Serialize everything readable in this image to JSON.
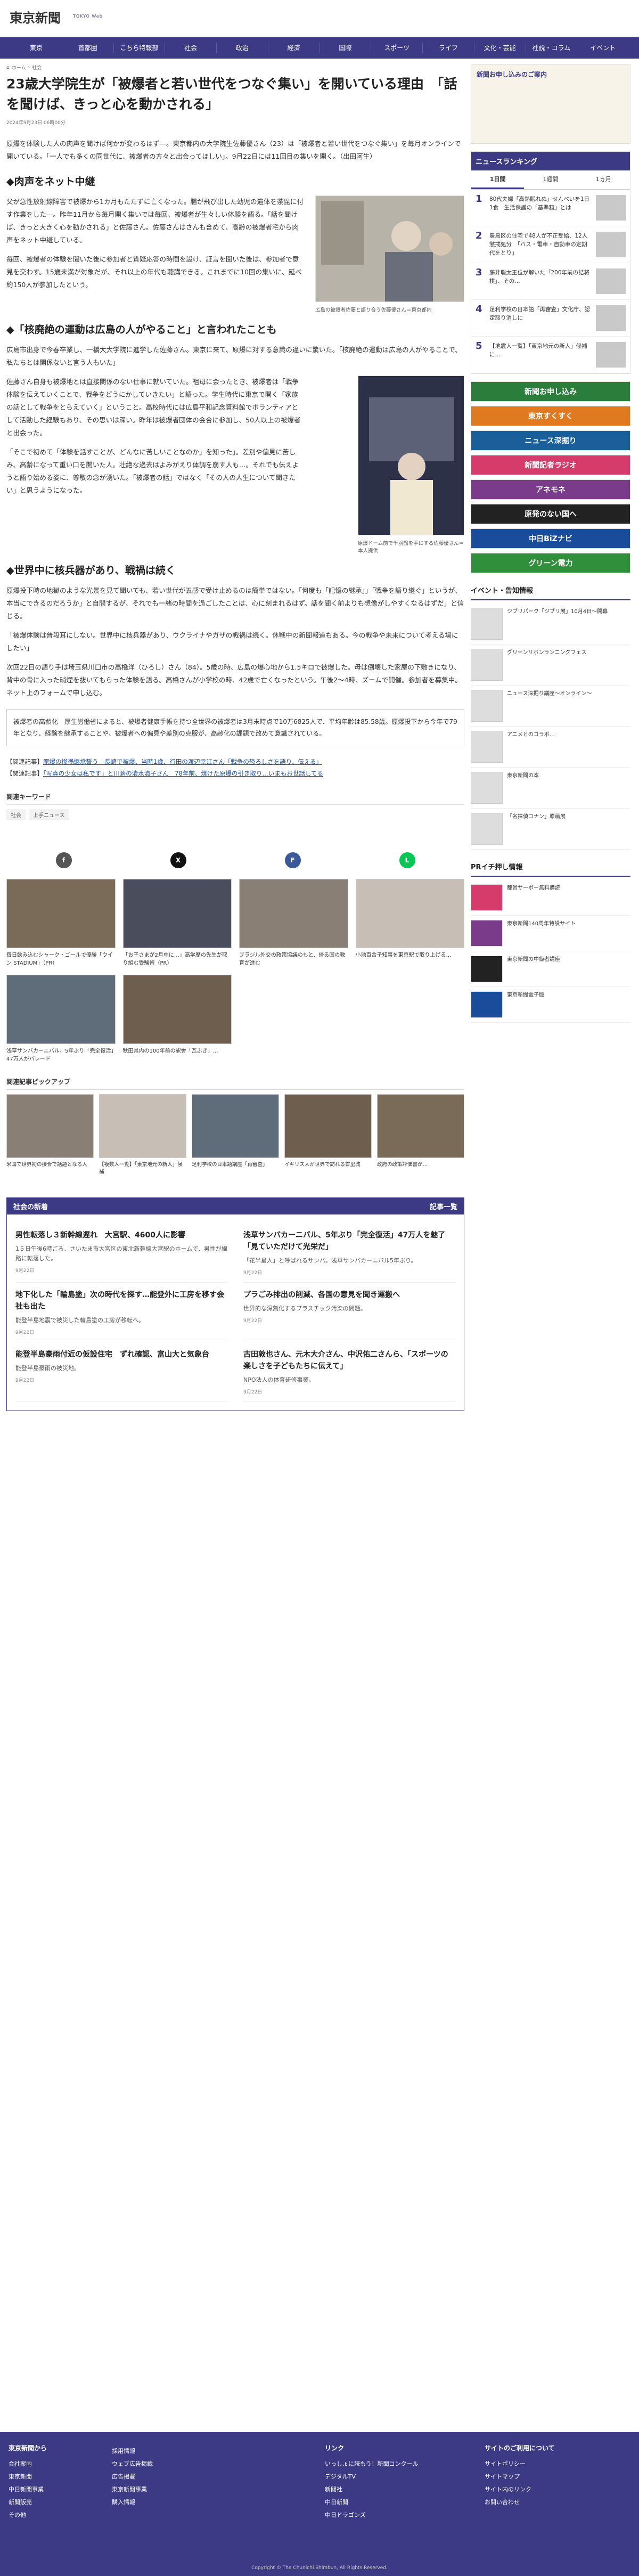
{
  "header": {
    "logo": "東京新聞",
    "logo_en": "TOKYO Web"
  },
  "nav": [
    "東京",
    "首都圏",
    "こちら特報部",
    "社会",
    "政治",
    "経済",
    "国際",
    "スポーツ",
    "ライフ",
    "文化・芸能",
    "社説・コラム",
    "イベント"
  ],
  "crumb": {
    "home": "ホーム",
    "section": "社会"
  },
  "article": {
    "title": "23歳大学院生が「被爆者と若い世代をつなぐ集い」を開いている理由　「話を聞けば、きっと心を動かされる」",
    "date": "2024年9月23日 06時00分",
    "p1": "原爆を体験した人の肉声を聞けば何かが変わるはず―。東京都内の大学院生佐藤優さん（23）は「被爆者と若い世代をつなぐ集い」を毎月オンラインで開いている。「一人でも多くの同世代に、被爆者の方々と出会ってほしい」。9月22日には11回目の集いを開く。（出田阿生）",
    "h_a": "◆肉声をネット中継",
    "p2": "父が急性放射線障害で被爆から1カ月もたたずに亡くなった。腸が飛び出した幼児の遺体を荼毘に付す作業をした―。昨年11月から毎月開く集いでは毎回、被爆者が生々しい体験を語る。「話を聞けば、きっと大きく心を動かされる」と佐藤さん。佐藤さんはさんも含めて、高齢の被爆者宅から肉声をネット中継している。",
    "p3": "毎回、被爆者の体験を聞いた後に参加者と質疑応答の時間を設け、証言を聞いた後は、参加者で意見を交わす。15歳未満が対象だが、それ以上の年代も聴講できる。これまでに10回の集いに、延べ約150人が参加したという。",
    "fig1_cap": "広島の被爆者佐藤と語り合う佐藤優さん＝東京都内",
    "h_b": "◆「核廃絶の運動は広島の人がやること」と言われたことも",
    "p4": "広島市出身で今春卒業し、一橋大大学院に進学した佐藤さん。東京に来て、原爆に対する意識の違いに驚いた。「核廃絶の運動は広島の人がやることで、私たちとは関係ないと言う人もいた」",
    "p5": "佐藤さん自身も被爆地とは直接関係のない仕事に就いていた。祖母に会ったとき、被爆者は「戦争体験を伝えていくことで、戦争をどうにかしていきたい」と語った。学生時代に東京で開く「家族の話として戦争をとらえていく」ということ。高校時代には広島平和記念資料館でボランティアとして活動した経験もあり、その思いは深い。昨年は被爆者団体の会合に参加し、50人以上の被爆者と出会った。",
    "p6": "「そこで初めて「体験を話すことが、どんなに苦しいことなのか」を知った」。差別や偏見に苦しみ、高齢になって重い口を開いた人。壮絶な過去はよみがえり体調を崩す人も…。それでも伝えようと語り始める姿に、尊敬の念が湧いた。「被爆者の話」ではなく「その人の人生について聞きたい」と思うようになった。",
    "fig2_cap": "原爆ドーム前で千羽鶴を手にする佐藤優さん＝本人提供",
    "h_c": "◆世界中に核兵器があり、戦禍は続く",
    "p7": "原爆投下時の地獄のような光景を見て聞いても、若い世代が五感で受け止めるのは簡単ではない。「何度も「記憶の継承」」「戦争を語り継ぐ」というが、本当にできるのだろうか」と自問するが、それでも一緒の時間を過ごしたことは、心に刻まれるはず。話を聞く前よりも想像がしやすくなるはずだ」と信じる。",
    "p8": "「被爆体験は普段耳にしない。世界中に核兵器があり、ウクライナやガザの戦禍は続く。休戦中の新聞報道もある。今の戦争や未来について考える場にしたい」",
    "p9": "次回22日の語り手は埼玉県川口市の高橋洋（ひろし）さん（84）。5歳の時、広島の爆心地から1.5キロで被爆した。母は倒壊した家屋の下敷きになり、背中の骨に入った硝煙を抜いてもらった体験を語る。高橋さんが小学校の時、42歳で亡くなったという。午後2〜4時、ズームで開催。参加者を募集中。ネット上のフォームで申し込む。",
    "form_link": "ネット上のフォーム",
    "note": "被爆者の高齢化　厚生労働省によると、被爆者健康手帳を持つ全世界の被爆者は3月末時点で10万6825人で、平均年齢は85.58歳。原爆投下から今年で79年となり、経験を継承することや、被爆者への偏見や差別の克服が、高齢化の課題で改めて意識されている。",
    "related1_lbl": "【関連記事】",
    "related1": "原爆の惨禍継承誓う　長崎で被爆、当時1歳、行田の渡辺幸江さん「戦争の恐ろしさを語り、伝える」",
    "related2_lbl": "【関連記事】",
    "related2": "「写真の少女は私です」と川崎の清水清子さん　78年前、焼けた原爆の引き取り…いまもお世話してる"
  },
  "keywords": {
    "title": "関連キーワード",
    "items": [
      "社会",
      "上手ニュース"
    ]
  },
  "share": [
    "f",
    "X",
    "F",
    "L"
  ],
  "cards": [
    {
      "t": "毎日飲み込むシャーク・ゴールで優勝「ウイン STADIUM」（PR）"
    },
    {
      "t": "「お子さまが2月中に…」高学歴の先生が取り組む受験術（PR）"
    },
    {
      "t": "ブラジル外交の政策協議のもと、帰る国の教育が進む"
    },
    {
      "t": "小池百合子知事を東京駅で取り上げる…"
    },
    {
      "t": "浅草サンバカーニバル、5年ぶり「完全復活」47万人がパレード"
    },
    {
      "t": "秋田県内の100年前の駅舎「瓦ぶき」…"
    }
  ],
  "pickup": {
    "title": "関連記事ピックアップ",
    "items": [
      {
        "t": "米国で世界初の接合で話題となる人"
      },
      {
        "t": "【複数人一覧】「東京地元の新人」候補"
      },
      {
        "t": "足利学校の日本語講座「再審査」"
      },
      {
        "t": "イギリス人が世界で訪れる首里城"
      },
      {
        "t": "政府の政策評価書が…"
      }
    ]
  },
  "recommend": {
    "head": "社会の新着",
    "more": "記事一覧",
    "items": [
      {
        "h": "男性転落し３新幹線遅れ　大宮駅、4600人に影響",
        "b": "1５日午後6時ごろ、さいたま市大宮区の東北新幹線大宮駅のホームで、男性が線路に転落した。",
        "d": "9月22日"
      },
      {
        "h": "浅草サンバカーニバル、5年ぶり「完全復活」47万人を魅了「見ていただけて光栄だ」",
        "b": "「花半星人」と呼ばれるサンバ。浅草サンバカーニバル5年ぶり。",
        "d": "9月22日"
      },
      {
        "h": "地下化した「輪島塗」次の時代を探す…能登外に工房を移す会社も出た",
        "b": "能登半島地震で被災した輪島塗の工房が移転へ。",
        "d": "9月22日"
      },
      {
        "h": "プラごみ排出の削減、各国の意見を聞き運搬へ",
        "b": "世界的な深刻化するプラスチック汚染の問題。",
        "d": "9月22日"
      },
      {
        "h": "能登半島豪雨付近の仮設住宅　ずれ確認、富山大と気象台",
        "b": "能登半島豪雨の被災地。",
        "d": "9月22日"
      },
      {
        "h": "古田敦也さん、元木大介さん、中沢佑二さんら、「スポーツの楽しさを子どもたちに伝えて」",
        "b": "NPO法人の体育研修事業。",
        "d": "9月22日"
      }
    ]
  },
  "side": {
    "promo": "新聞お申し込みのご案内",
    "rank_head": "ニュースランキング",
    "tabs": [
      "1日間",
      "1週間",
      "1ヵ月"
    ],
    "rank": [
      {
        "n": "1",
        "t": "80代夫婦「高熱眠れぬ」せんべいを1日1食　生活保護の「基準額」とは"
      },
      {
        "n": "2",
        "t": "豊島区の住宅で48人が不正受給、12人懲戒処分　「バス・電車・自動車の定期代をとり」"
      },
      {
        "n": "3",
        "t": "藤井聡太王位が解いた「200年前の詰将棋」、その…"
      },
      {
        "n": "4",
        "t": "足利学校の日本語「再審査」文化庁、認定取り消しに"
      },
      {
        "n": "5",
        "t": "【地震人一覧】「東京地元の新人」候補に…"
      }
    ],
    "banners": [
      "新聞お申し込み",
      "東京すくすく",
      "ニュース深掘り",
      "新聞記者ラジオ",
      "アネモネ",
      "原発のない国へ",
      "中日BiZナビ",
      "グリーン電力"
    ],
    "events_title": "イベント・告知情報",
    "events": [
      {
        "t": "ジブリパーク「ジブリ展」10月4日〜開幕"
      },
      {
        "t": "グリーンリボンランニングフェス"
      },
      {
        "t": "ニュース深掘り講座〜オンライン〜"
      },
      {
        "t": "アニメとのコラボ…"
      },
      {
        "t": "東京新聞の本"
      },
      {
        "t": "「名探偵コナン」原画展"
      }
    ],
    "pr_title": "PRイチ押し情報",
    "pr": [
      {
        "t": "都営サーボー無料購読"
      },
      {
        "t": "東京新聞140周年特設サイト"
      },
      {
        "t": "東京新聞の中級者講座"
      },
      {
        "t": "東京新聞電子版"
      }
    ]
  },
  "footer": {
    "col1": {
      "h": "東京新聞から",
      "items": [
        "会社案内",
        "東京新聞",
        "中日新聞事業",
        "新聞販売",
        "その他"
      ]
    },
    "col2": {
      "h": "",
      "items": [
        "採用情報",
        "ウェブ広告掲載",
        "広告掲載",
        "東京新聞事業",
        "購入情報"
      ]
    },
    "col3": {
      "h": "リンク",
      "items": [
        "いっしょに読もう！新聞コンクール",
        "デジタルTV",
        "新聞社",
        "中日新聞",
        "中日ドラゴンズ"
      ]
    },
    "col4": {
      "h": "サイトのご利用について",
      "items": [
        "サイトポリシー",
        "サイトマップ",
        "サイト内のリンク",
        "お問い合わせ"
      ]
    },
    "copy": "Copyright © The Chunichi Shimbun, All Rights Reserved."
  }
}
